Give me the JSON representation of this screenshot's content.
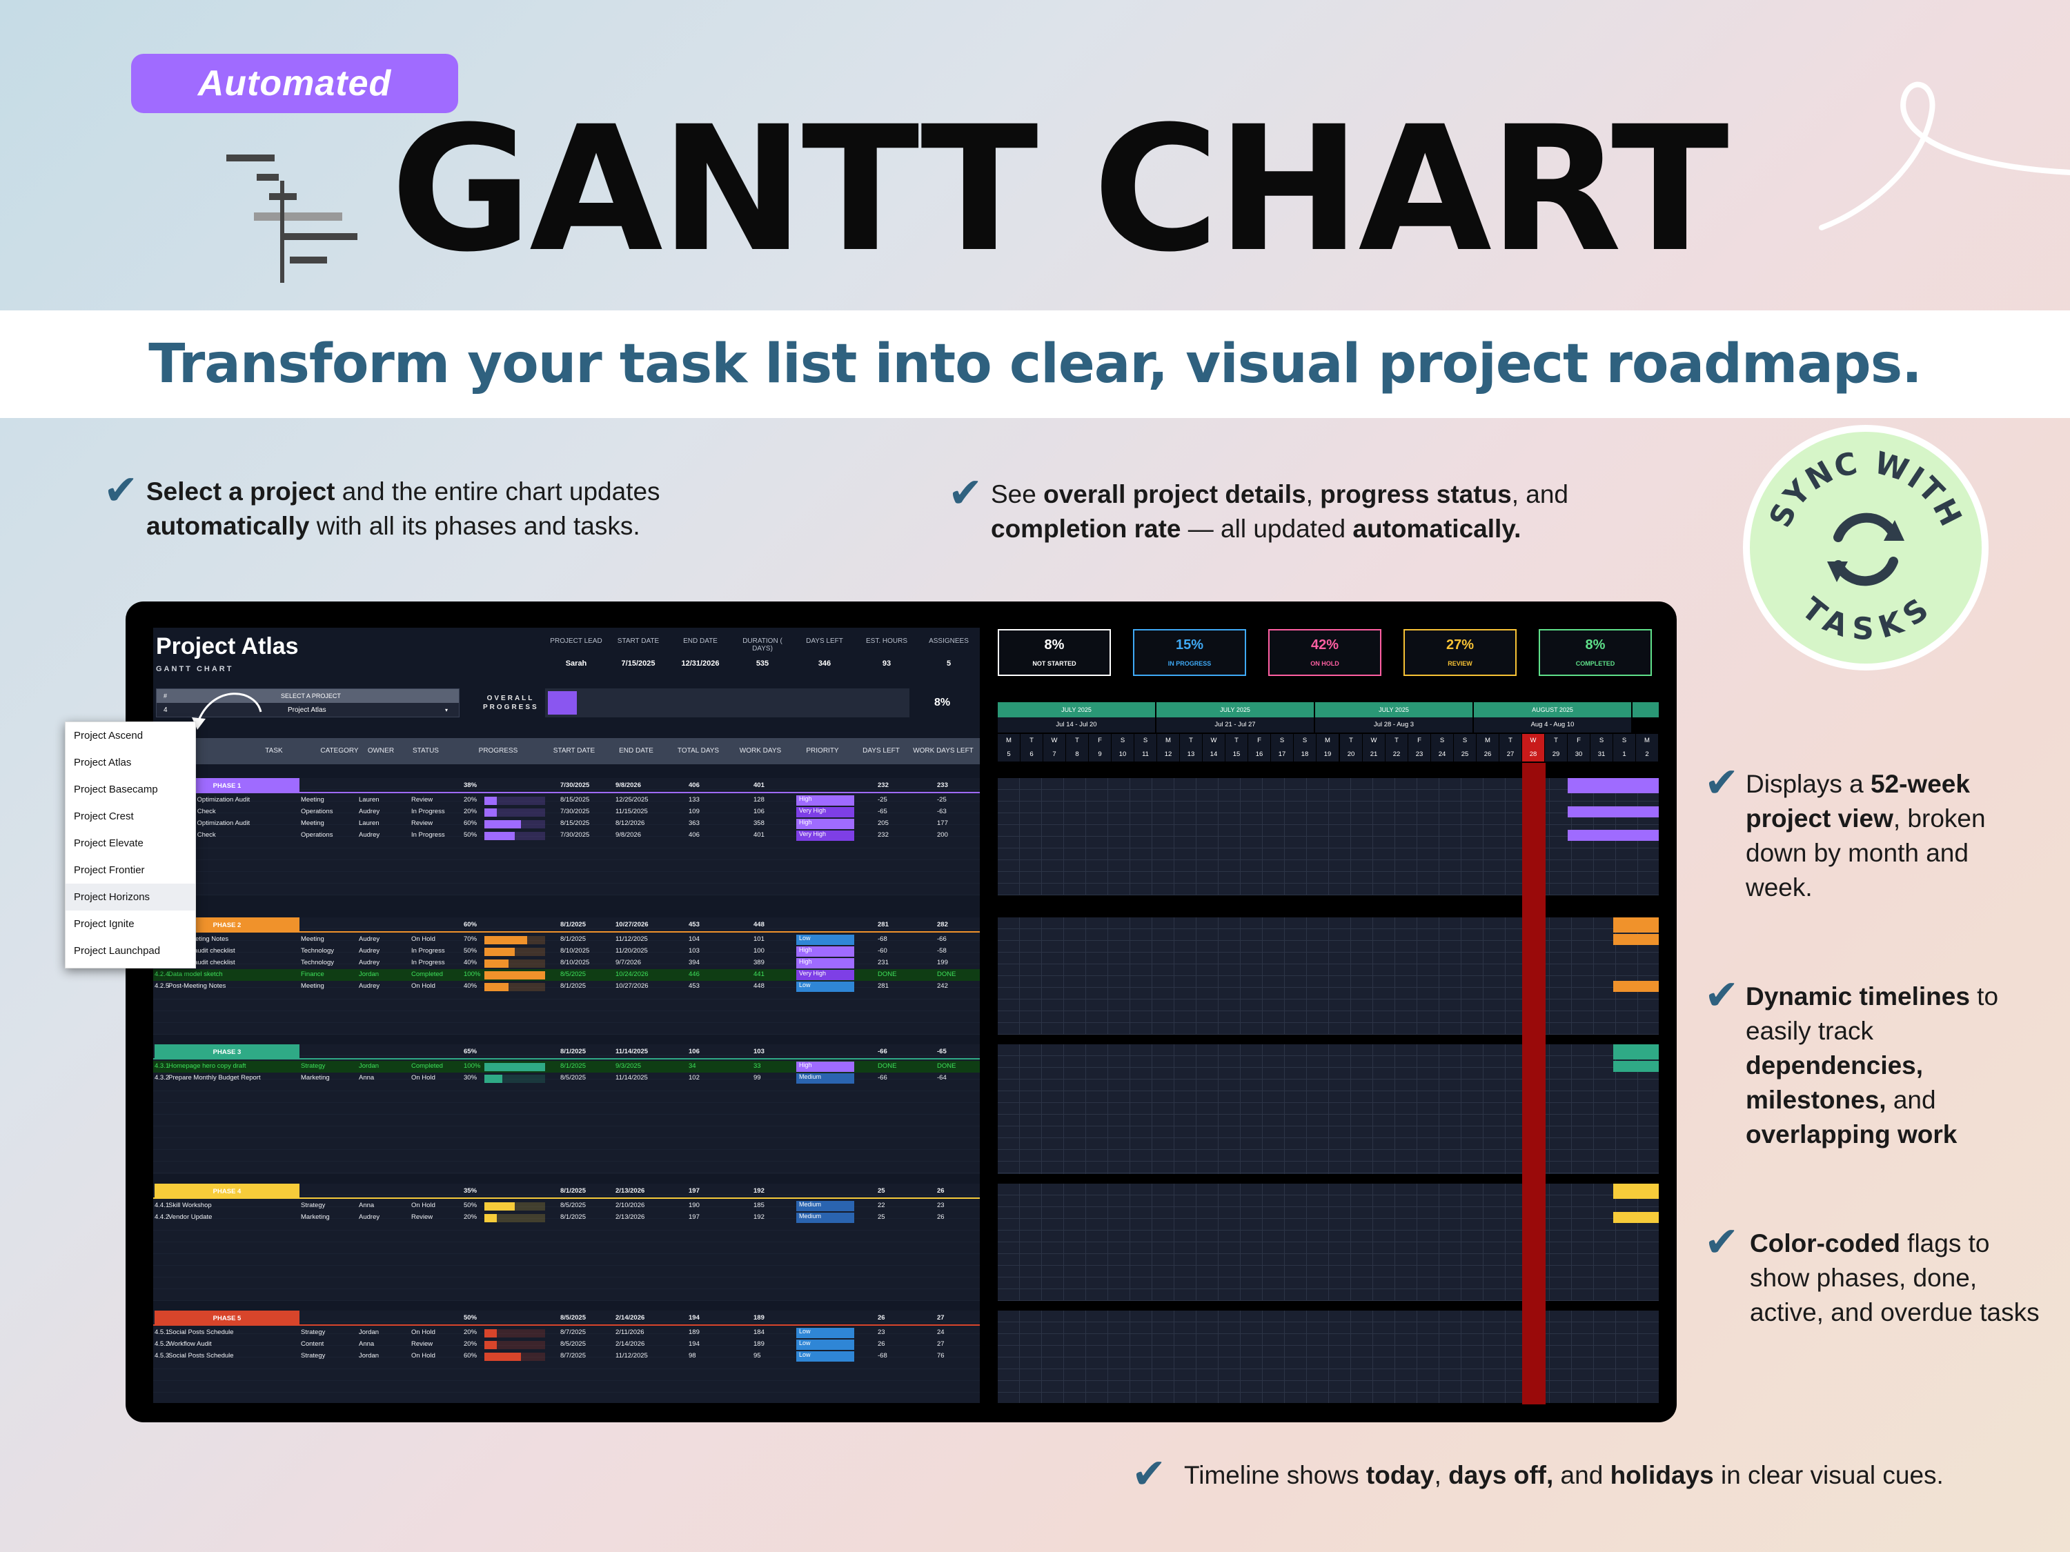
{
  "header": {
    "badge": "Automated",
    "title": "GANTT CHART",
    "tagline": "Transform your task list into clear, visual project roadmaps."
  },
  "features": {
    "f1": [
      "Select a project",
      " and the entire chart updates ",
      "automatically",
      " with all its phases and tasks."
    ],
    "f2": [
      "See ",
      "overall project details",
      ", ",
      "progress status",
      ", and ",
      "completion rate",
      " — all updated ",
      "automatically."
    ],
    "f3": [
      "Displays a ",
      "52-week project view",
      ", broken down by month and week."
    ],
    "f4": [
      "Dynamic timelines",
      " to easily track ",
      "dependencies, milestones,",
      " and ",
      "overlapping work"
    ],
    "f5": [
      "Color-coded",
      " flags to show phases, done, active, and overdue tasks"
    ],
    "f6": [
      "Timeline shows ",
      "today",
      ", ",
      "days off,",
      " and ",
      "holidays",
      " in clear visual cues."
    ]
  },
  "sync_badge": {
    "top": "SYNC WITH",
    "bottom": "TASKS"
  },
  "project": {
    "name": "Project Atlas",
    "subtitle": "GANTT CHART",
    "fields": [
      {
        "label": "PROJECT LEAD",
        "value": "Sarah"
      },
      {
        "label": "START DATE",
        "value": "7/15/2025"
      },
      {
        "label": "END DATE",
        "value": "12/31/2026"
      },
      {
        "label": "DURATION ( DAYS)",
        "value": "535"
      },
      {
        "label": "DAYS LEFT",
        "value": "346"
      },
      {
        "label": "EST. HOURS",
        "value": "93"
      },
      {
        "label": "ASSIGNEES",
        "value": "5"
      }
    ],
    "select_hash": "#",
    "select_label": "SELECT A PROJECT",
    "select_num": "4",
    "select_value": "Project Atlas",
    "overall_label": "OVERALL PROGRESS",
    "overall_pct": "8%",
    "overall_progress": 0.08
  },
  "dropdown": [
    "Project Ascend",
    "Project Atlas",
    "Project Basecamp",
    "Project Crest",
    "Project Elevate",
    "Project Frontier",
    "Project Horizons",
    "Project Ignite",
    "Project Launchpad"
  ],
  "stats": [
    {
      "value": "8%",
      "label": "NOT STARTED",
      "color": "#ffffff"
    },
    {
      "value": "15%",
      "label": "IN PROGRESS",
      "color": "#3fa9f5"
    },
    {
      "value": "42%",
      "label": "ON HOLD",
      "color": "#ff5fa2"
    },
    {
      "value": "27%",
      "label": "REVIEW",
      "color": "#f7c235"
    },
    {
      "value": "8%",
      "label": "COMPLETED",
      "color": "#5fe08a"
    }
  ],
  "columns": [
    "#",
    "TASK",
    "CATEGORY",
    "OWNER",
    "STATUS",
    "PROGRESS",
    "START DATE",
    "END DATE",
    "TOTAL DAYS",
    "WORK DAYS",
    "PRIORITY",
    "DAYS LEFT",
    "WORK DAYS LEFT"
  ],
  "phases": [
    {
      "name": "PHASE 1",
      "color": "#9f6bff",
      "pct": "38%",
      "start": "7/30/2025",
      "end": "9/8/2026",
      "total": "406",
      "work": "401",
      "left": "232",
      "wleft": "233",
      "tasks": [
        {
          "id": "4.1.1",
          "task": "Workflow Optimization Audit",
          "cat": "Meeting",
          "owner": "Lauren",
          "status": "Review",
          "pct": "20%",
          "start": "8/15/2025",
          "end": "12/25/2025",
          "total": "133",
          "work": "128",
          "prio": "High",
          "left": "-25",
          "wleft": "-25"
        },
        {
          "id": "4.1.2",
          "task": "Inventory Check",
          "cat": "Operations",
          "owner": "Audrey",
          "status": "In Progress",
          "pct": "20%",
          "start": "7/30/2025",
          "end": "11/15/2025",
          "total": "109",
          "work": "106",
          "prio": "Very High",
          "left": "-65",
          "wleft": "-63"
        },
        {
          "id": "4.1.3",
          "task": "Workflow Optimization Audit",
          "cat": "Meeting",
          "owner": "Lauren",
          "status": "Review",
          "pct": "60%",
          "start": "8/15/2025",
          "end": "8/12/2026",
          "total": "363",
          "work": "358",
          "prio": "High",
          "left": "205",
          "wleft": "177"
        },
        {
          "id": "4.1.4",
          "task": "Inventory Check",
          "cat": "Operations",
          "owner": "Audrey",
          "status": "In Progress",
          "pct": "50%",
          "start": "7/30/2025",
          "end": "9/8/2026",
          "total": "406",
          "work": "401",
          "prio": "Very High",
          "left": "232",
          "wleft": "200"
        }
      ]
    },
    {
      "name": "PHASE 2",
      "color": "#f0922b",
      "pct": "60%",
      "start": "8/1/2025",
      "end": "10/27/2026",
      "total": "453",
      "work": "448",
      "left": "281",
      "wleft": "282",
      "tasks": [
        {
          "id": "4.2.1",
          "task": "Team Meeting Notes",
          "cat": "Meeting",
          "owner": "Audrey",
          "status": "On Hold",
          "pct": "70%",
          "start": "8/1/2025",
          "end": "11/12/2025",
          "total": "104",
          "work": "101",
          "prio": "Low",
          "left": "-68",
          "wleft": "-66"
        },
        {
          "id": "4.2.2",
          "task": "Security audit checklist",
          "cat": "Technology",
          "owner": "Audrey",
          "status": "In Progress",
          "pct": "50%",
          "start": "8/10/2025",
          "end": "11/20/2025",
          "total": "103",
          "work": "100",
          "prio": "High",
          "left": "-60",
          "wleft": "-58"
        },
        {
          "id": "4.2.3",
          "task": "Security audit checklist",
          "cat": "Technology",
          "owner": "Audrey",
          "status": "In Progress",
          "pct": "40%",
          "start": "8/10/2025",
          "end": "9/7/2026",
          "total": "394",
          "work": "389",
          "prio": "High",
          "left": "231",
          "wleft": "199"
        },
        {
          "id": "4.2.4",
          "task": "Data model sketch",
          "cat": "Finance",
          "owner": "Jordan",
          "status": "Completed",
          "pct": "100%",
          "start": "8/5/2025",
          "end": "10/24/2026",
          "total": "446",
          "work": "441",
          "prio": "Very High",
          "left": "DONE",
          "wleft": "DONE",
          "done": true
        },
        {
          "id": "4.2.5",
          "task": "Post-Meeting Notes",
          "cat": "Meeting",
          "owner": "Audrey",
          "status": "On Hold",
          "pct": "40%",
          "start": "8/1/2025",
          "end": "10/27/2026",
          "total": "453",
          "work": "448",
          "prio": "Low",
          "left": "281",
          "wleft": "242"
        }
      ]
    },
    {
      "name": "PHASE 3",
      "color": "#2faa86",
      "pct": "65%",
      "start": "8/1/2025",
      "end": "11/14/2025",
      "total": "106",
      "work": "103",
      "left": "-66",
      "wleft": "-65",
      "tasks": [
        {
          "id": "4.3.1",
          "task": "Homepage hero copy draft",
          "cat": "Strategy",
          "owner": "Jordan",
          "status": "Completed",
          "pct": "100%",
          "start": "8/1/2025",
          "end": "9/3/2025",
          "total": "34",
          "work": "33",
          "prio": "High",
          "left": "DONE",
          "wleft": "DONE",
          "done": true
        },
        {
          "id": "4.3.2",
          "task": "Prepare Monthly Budget Report",
          "cat": "Marketing",
          "owner": "Anna",
          "status": "On Hold",
          "pct": "30%",
          "start": "8/5/2025",
          "end": "11/14/2025",
          "total": "102",
          "work": "99",
          "prio": "Medium",
          "left": "-66",
          "wleft": "-64"
        }
      ]
    },
    {
      "name": "PHASE 4",
      "color": "#f7cc3a",
      "pct": "35%",
      "start": "8/1/2025",
      "end": "2/13/2026",
      "total": "197",
      "work": "192",
      "left": "25",
      "wleft": "26",
      "tasks": [
        {
          "id": "4.4.1",
          "task": "Skill Workshop",
          "cat": "Strategy",
          "owner": "Anna",
          "status": "On Hold",
          "pct": "50%",
          "start": "8/5/2025",
          "end": "2/10/2026",
          "total": "190",
          "work": "185",
          "prio": "Medium",
          "left": "22",
          "wleft": "23"
        },
        {
          "id": "4.4.2",
          "task": "Vendor Update",
          "cat": "Marketing",
          "owner": "Audrey",
          "status": "Review",
          "pct": "20%",
          "start": "8/1/2025",
          "end": "2/13/2026",
          "total": "197",
          "work": "192",
          "prio": "Medium",
          "left": "25",
          "wleft": "26"
        }
      ]
    },
    {
      "name": "PHASE 5",
      "color": "#d8452b",
      "pct": "50%",
      "start": "8/5/2025",
      "end": "2/14/2026",
      "total": "194",
      "work": "189",
      "left": "26",
      "wleft": "27",
      "tasks": [
        {
          "id": "4.5.1",
          "task": "Social Posts Schedule",
          "cat": "Strategy",
          "owner": "Jordan",
          "status": "On Hold",
          "pct": "20%",
          "start": "8/7/2025",
          "end": "2/11/2026",
          "total": "189",
          "work": "184",
          "prio": "Low",
          "left": "23",
          "wleft": "24"
        },
        {
          "id": "4.5.2",
          "task": "Workflow Audit",
          "cat": "Content",
          "owner": "Anna",
          "status": "Review",
          "pct": "20%",
          "start": "8/5/2025",
          "end": "2/14/2026",
          "total": "194",
          "work": "189",
          "prio": "Low",
          "left": "26",
          "wleft": "27"
        },
        {
          "id": "4.5.3",
          "task": "Social Posts Schedule",
          "cat": "Strategy",
          "owner": "Jordan",
          "status": "On Hold",
          "pct": "60%",
          "start": "8/7/2025",
          "end": "11/12/2025",
          "total": "98",
          "work": "95",
          "prio": "Low",
          "left": "-68",
          "wleft": "76"
        }
      ]
    }
  ],
  "timeline": {
    "months": [
      "JULY 2025",
      "JULY 2025",
      "JULY 2025",
      "AUGUST 2025"
    ],
    "weeks": [
      "Jul 14 - Jul 20",
      "Jul 21 - Jul 27",
      "Jul 28 - Aug 3",
      "Aug 4 - Aug 10"
    ],
    "day_letters": [
      "M",
      "T",
      "W",
      "T",
      "F",
      "S",
      "S",
      "M",
      "T",
      "W",
      "T",
      "F",
      "S",
      "S",
      "M",
      "T",
      "W",
      "T",
      "F",
      "S",
      "S",
      "M",
      "T",
      "W",
      "T",
      "F",
      "S",
      "S",
      "M",
      "T",
      "W",
      "T",
      "F",
      "S",
      "S",
      "M"
    ],
    "day_numbers": [
      "5",
      "6",
      "7",
      "8",
      "9",
      "10",
      "11",
      "12",
      "13",
      "14",
      "15",
      "16",
      "17",
      "18",
      "19",
      "20",
      "21",
      "22",
      "23",
      "24",
      "25",
      "26",
      "27",
      "28",
      "29",
      "30",
      "31",
      "1",
      "2"
    ],
    "today_index": 23,
    "today_color": "#9a0a0a"
  }
}
